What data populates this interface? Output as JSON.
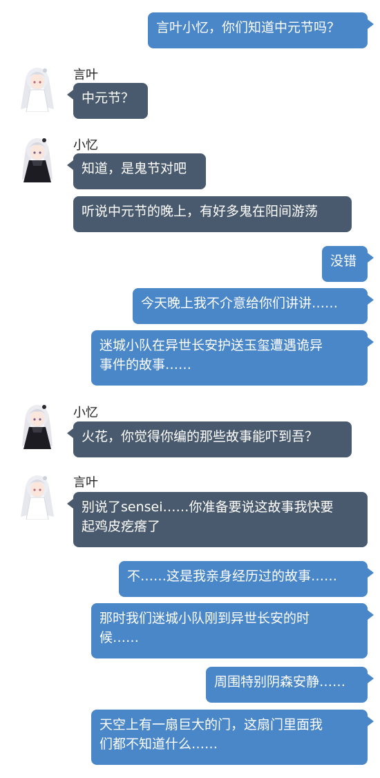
{
  "senders": {
    "yanye": "言叶",
    "xiaoyi": "小忆"
  },
  "messages": [
    {
      "text": "言叶小忆，你们知道中元节吗？"
    },
    {
      "text": "中元节？"
    },
    {
      "text": "知道，是鬼节对吧"
    },
    {
      "text": "听说中元节的晚上，有好多鬼在阳间游荡"
    },
    {
      "text": "没错"
    },
    {
      "text": "今天晚上我不介意给你们讲讲……"
    },
    {
      "text": "迷城小队在异世长安护送玉玺遭遇诡异\n事件的故事……"
    },
    {
      "text": "火花，你觉得你编的那些故事能吓到吾？"
    },
    {
      "text": "别说了sensei……你准备要说这故事我快要\n起鸡皮疙瘩了"
    },
    {
      "text": "不……这是我亲身经历过的故事……"
    },
    {
      "text": "那时我们迷城小队刚到异世长安的时\n候……"
    },
    {
      "text": "周围特别阴森安静……"
    },
    {
      "text": "天空上有一扇巨大的门，这扇门里面我\n们都不知道什么……"
    }
  ]
}
